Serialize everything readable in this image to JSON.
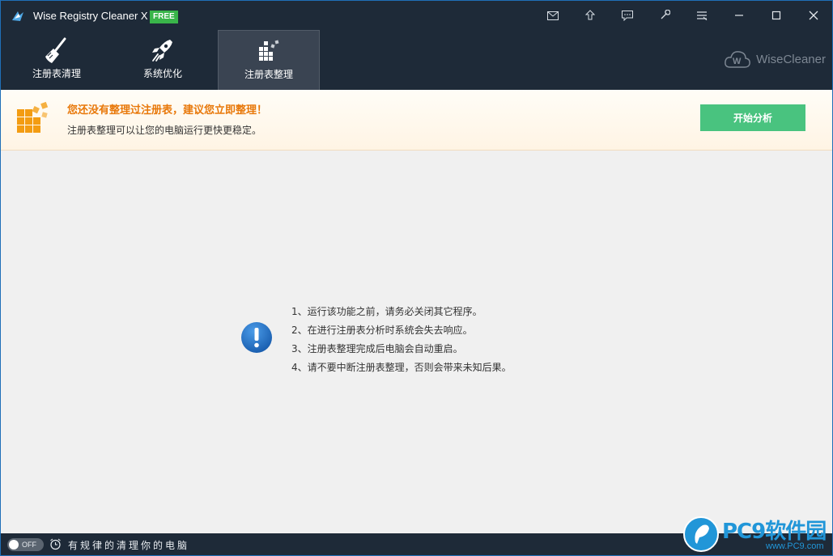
{
  "window": {
    "title": "Wise Registry Cleaner X",
    "badge": "FREE"
  },
  "titlebar_buttons": [
    {
      "name": "mail-icon"
    },
    {
      "name": "upgrade-icon"
    },
    {
      "name": "feedback-icon"
    },
    {
      "name": "skin-icon"
    },
    {
      "name": "menu-icon"
    },
    {
      "name": "minimize-icon"
    },
    {
      "name": "maximize-icon"
    },
    {
      "name": "close-icon"
    }
  ],
  "tabs": [
    {
      "label": "注册表清理",
      "icon": "broom-icon",
      "active": false
    },
    {
      "label": "系统优化",
      "icon": "rocket-icon",
      "active": false
    },
    {
      "label": "注册表整理",
      "icon": "defrag-blocks-icon",
      "active": true
    }
  ],
  "brand": {
    "text": "WiseCleaner"
  },
  "notice": {
    "title": "您还没有整理过注册表，建议您立即整理！",
    "description": "注册表整理可以让您的电脑运行更快更稳定。",
    "button": "开始分析"
  },
  "tips": [
    "1、运行该功能之前，请务必关闭其它程序。",
    "2、在进行注册表分析时系统会失去响应。",
    "3、注册表整理完成后电脑会自动重启。",
    "4、请不要中断注册表整理，否则会带来未知后果。"
  ],
  "statusbar": {
    "toggle_label": "OFF",
    "schedule_text": "有规律的清理你的电脑"
  },
  "watermark": {
    "text": "PC9软件园",
    "sub": "www.PC9.com"
  },
  "colors": {
    "titlebar": "#1e2a38",
    "active_tab": "#3a4452",
    "accent_orange": "#e8780a",
    "button_green": "#49c37f",
    "badge_green": "#39b54a",
    "info_blue": "#1f6fc5"
  }
}
